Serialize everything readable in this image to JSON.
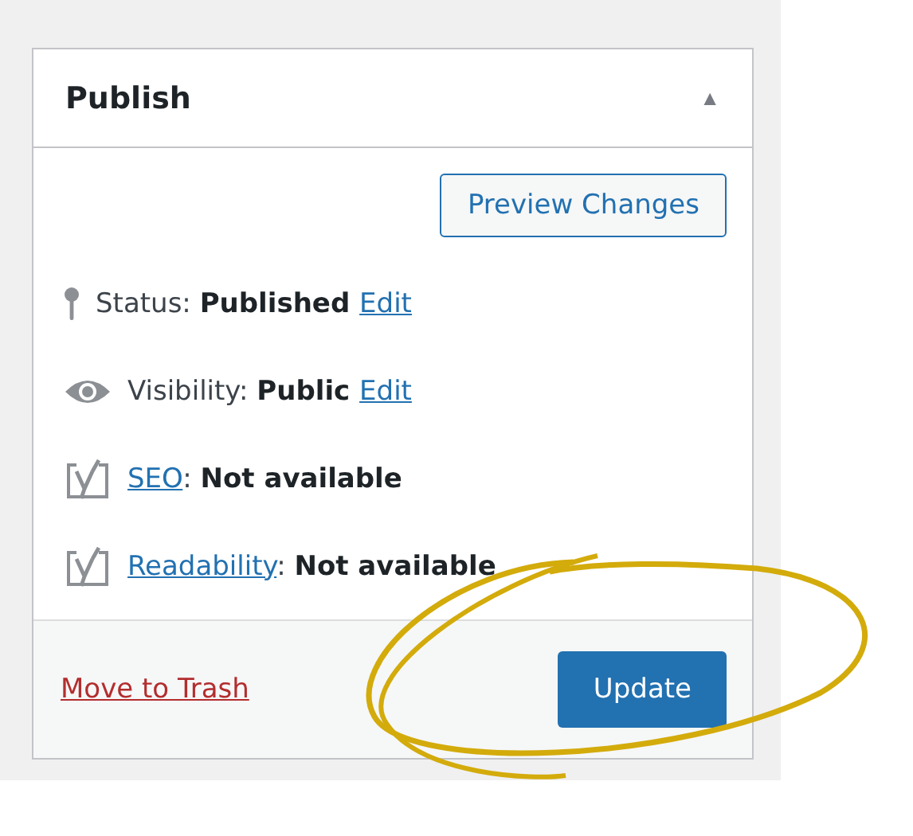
{
  "panel": {
    "title": "Publish",
    "collapse_icon": "▲",
    "expanded": true
  },
  "preview_button": "Preview Changes",
  "rows": [
    {
      "kind": "status",
      "parts": [
        {
          "kind": "plain",
          "text": "Status: "
        },
        {
          "kind": "bold",
          "text": "Published "
        },
        {
          "kind": "link",
          "text": "Edit"
        }
      ]
    },
    {
      "kind": "visibility",
      "parts": [
        {
          "kind": "plain",
          "text": "Visibility: "
        },
        {
          "kind": "bold",
          "text": "Public "
        },
        {
          "kind": "link",
          "text": "Edit"
        }
      ]
    },
    {
      "kind": "analysis",
      "parts": [
        {
          "kind": "link",
          "text": "SEO"
        },
        {
          "kind": "plain",
          "text": ": "
        },
        {
          "kind": "bold",
          "text": "Not available"
        }
      ]
    },
    {
      "kind": "analysis",
      "parts": [
        {
          "kind": "link",
          "text": "Readability"
        },
        {
          "kind": "plain",
          "text": ": "
        },
        {
          "kind": "bold",
          "text": "Not available"
        }
      ]
    }
  ],
  "footer": {
    "trash_link": "Move to Trash",
    "update_button": "Update"
  }
}
